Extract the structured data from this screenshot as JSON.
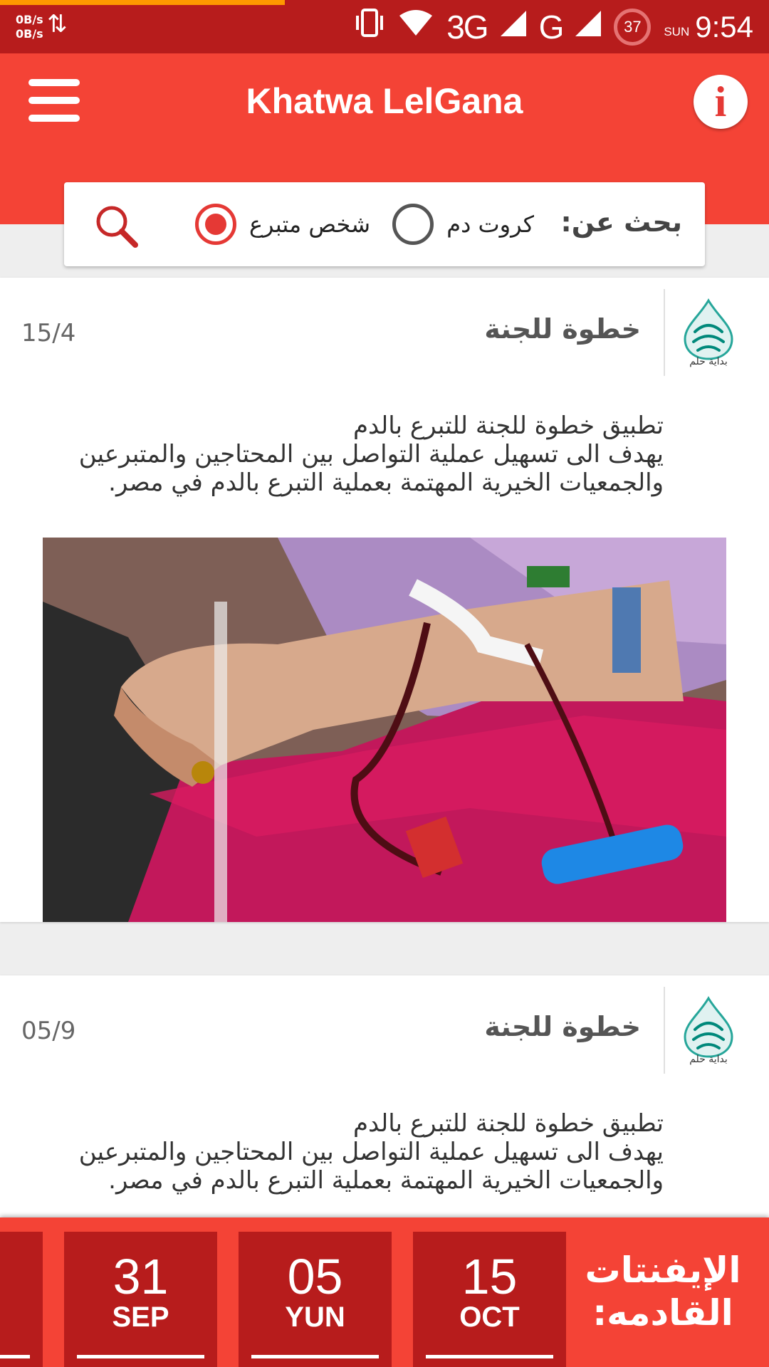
{
  "status_bar": {
    "net_up": "0B/s",
    "net_down": "0B/s",
    "network_3g": "3G",
    "network_g": "G",
    "battery": "37",
    "day": "SUN",
    "time": "9:54"
  },
  "app_bar": {
    "title": "Khatwa LelGana",
    "menu_icon": "hamburger-menu-icon",
    "info_icon": "info-icon"
  },
  "search": {
    "label": "بحث عن:",
    "options": [
      {
        "label": "كروت دم",
        "checked": false
      },
      {
        "label": "شخص متبرع",
        "checked": true
      }
    ],
    "icon": "search-icon"
  },
  "posts": [
    {
      "author": "خطوة للجنة",
      "logo_tagline": "بداية حلم",
      "date": "15/4",
      "lines": [
        "تطبيق خطوة للجنة للتبرع بالدم",
        "يهدف الى تسهيل عملية التواصل بين المحتاجين والمتبرعين",
        "والجمعيات الخيرية المهتمة بعملية التبرع بالدم في مصر."
      ]
    },
    {
      "author": "خطوة للجنة",
      "logo_tagline": "بداية حلم",
      "date": "05/9",
      "lines": [
        "تطبيق خطوة للجنة للتبرع بالدم",
        "يهدف الى تسهيل عملية التواصل بين المحتاجين والمتبرعين",
        "والجمعيات الخيرية المهتمة بعملية التبرع بالدم في مصر."
      ]
    }
  ],
  "events": {
    "label_line1": "الإيفنتات",
    "label_line2": "القادمه:",
    "items": [
      {
        "day": "15",
        "month": "OCT"
      },
      {
        "day": "05",
        "month": "YUN"
      },
      {
        "day": "31",
        "month": "SEP"
      }
    ]
  },
  "colors": {
    "primary": "#f44336",
    "primary_dark": "#b71c1c",
    "accent": "#e53935"
  }
}
